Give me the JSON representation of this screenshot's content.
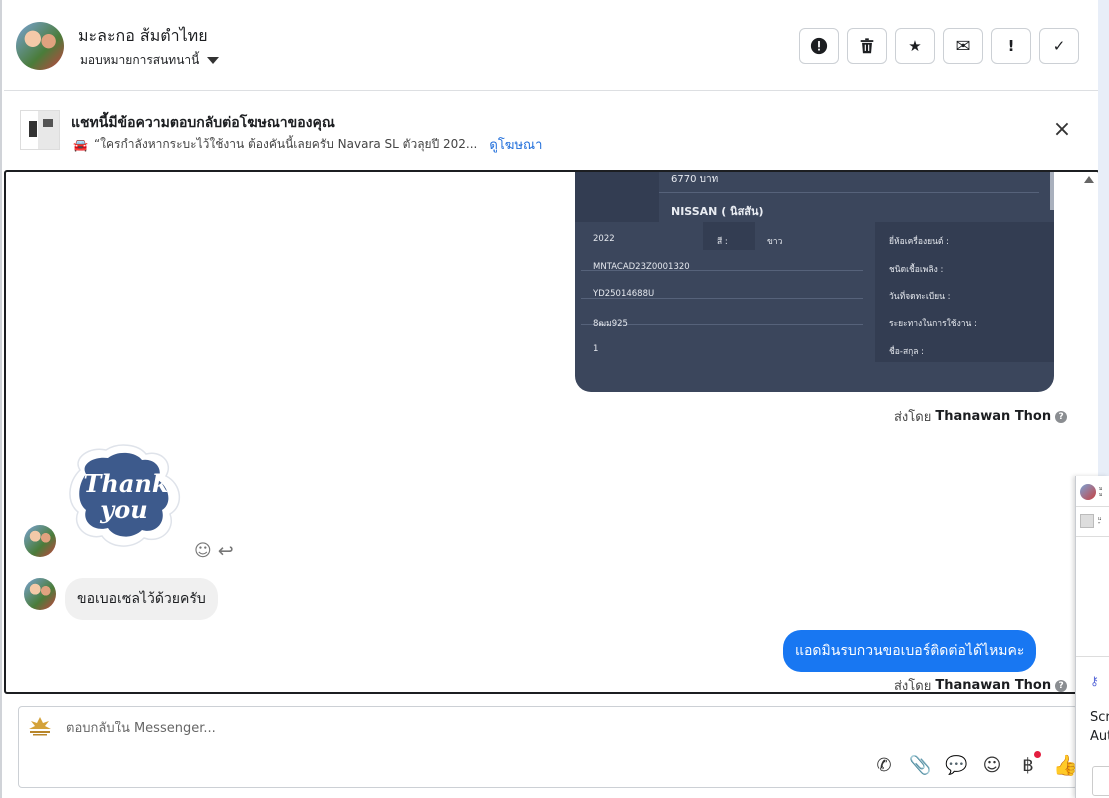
{
  "header": {
    "contact_name": "มะละกอ ส้มตำไทย",
    "assign_label": "มอบหมายการสนทนานี้"
  },
  "actions": [
    {
      "name": "report-button",
      "icon": "alert-circle-icon",
      "glyph": "!"
    },
    {
      "name": "delete-button",
      "icon": "trash-icon",
      "glyph": ""
    },
    {
      "name": "star-button",
      "icon": "star-icon",
      "glyph": "★"
    },
    {
      "name": "email-button",
      "icon": "envelope-icon",
      "glyph": "✉"
    },
    {
      "name": "spam-button",
      "icon": "exclamation-icon",
      "glyph": "!"
    },
    {
      "name": "done-button",
      "icon": "check-icon",
      "glyph": "✓"
    }
  ],
  "ad_banner": {
    "title": "แชทนี้มีข้อความตอบกลับต่อโฆษณาของคุณ",
    "subtitle": "“ใครกำลังหากระบะไว้ใช้งาน ต้องคันนี้เลยครับ Navara SL ตัวลุยปี 202...",
    "link": "ดูโฆษณา"
  },
  "vehicle_card": {
    "price": "6770 บาท",
    "brand": "NISSAN ( นิสสัน)",
    "rows": [
      {
        "left": "2022",
        "mid_label": "สี :",
        "mid_value": "ขาว",
        "right": "ยี่ห้อเครื่องยนต์ :"
      },
      {
        "left": "MNTACAD23Z0001320",
        "right": "ชนิดเชื้อเพลิง :"
      },
      {
        "left": "YD25014688U",
        "right": "วันที่จดทะเบียน :"
      },
      {
        "left": "8ฒม925",
        "right": "ระยะทางในการใช้งาน :"
      },
      {
        "left": "1",
        "right": "ชื่อ-สกุล :"
      }
    ]
  },
  "messages": {
    "sent_by_prefix": "ส่งโดย",
    "sent_by_name": "Thanawan Thon",
    "sticker_text_1": "Thank",
    "sticker_text_2": "you",
    "incoming_text": "ขอเบอเซลไว้ด้วยครับ",
    "outgoing_text": "แอดมินรบกวนขอเบอร์ติดต่อได้ไหมคะ"
  },
  "composer": {
    "placeholder": "ตอบกลับใน Messenger..."
  },
  "overlay": {
    "partial_text_1": "Scr",
    "partial_text_2": "Aut"
  },
  "colors": {
    "accent": "#1877f2",
    "card_bg": "#3b465c",
    "link": "#216fdb"
  }
}
